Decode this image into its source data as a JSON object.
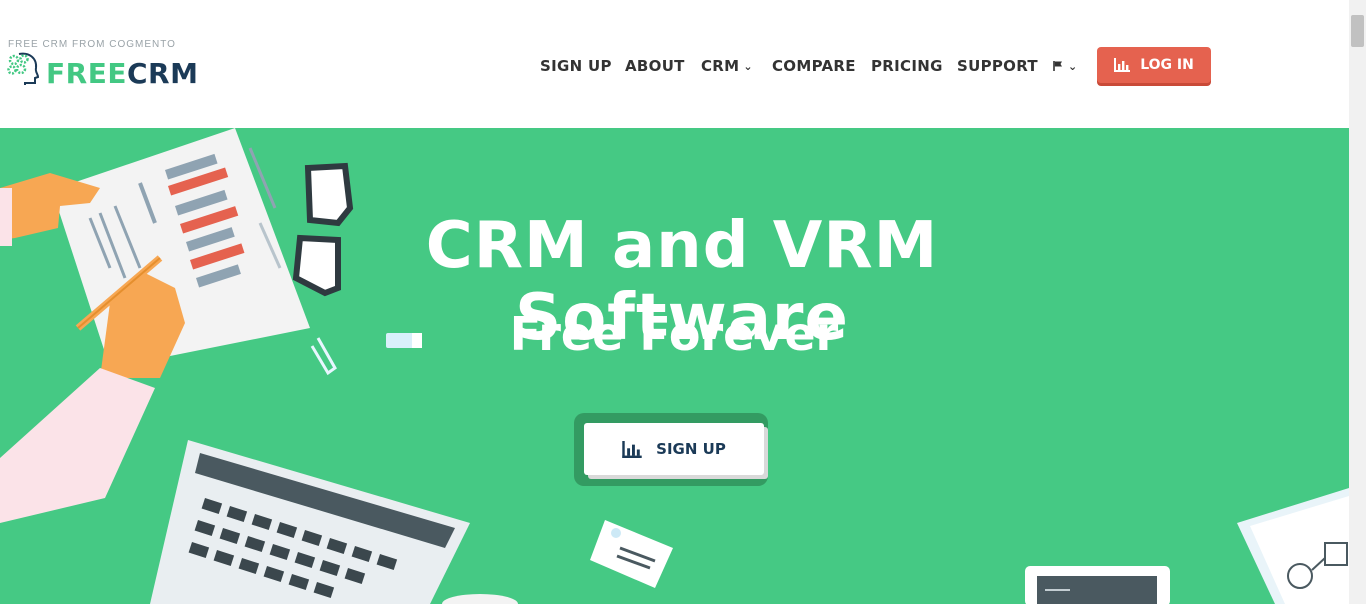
{
  "brand": {
    "tagline": "FREE CRM FROM COGMENTO",
    "name_part1": "FREE",
    "name_part2": "CRM",
    "icon": "head-gears-icon",
    "colors": {
      "green": "#43c883",
      "navy": "#1b3a57"
    }
  },
  "nav": {
    "items": [
      {
        "label": "SIGN UP"
      },
      {
        "label": "ABOUT"
      },
      {
        "label": "CRM",
        "dropdown": true
      },
      {
        "label": "COMPARE"
      },
      {
        "label": "PRICING"
      },
      {
        "label": "SUPPORT"
      }
    ],
    "language_icon": "flag-icon",
    "login": {
      "label": "LOG IN",
      "icon": "bar-chart-icon",
      "color": "#e5624f"
    }
  },
  "hero": {
    "headline": "CRM and VRM Software",
    "subline": "Free Forever",
    "cta": {
      "label": "SIGN UP",
      "icon": "bar-chart-icon"
    },
    "background": "#45c984"
  }
}
